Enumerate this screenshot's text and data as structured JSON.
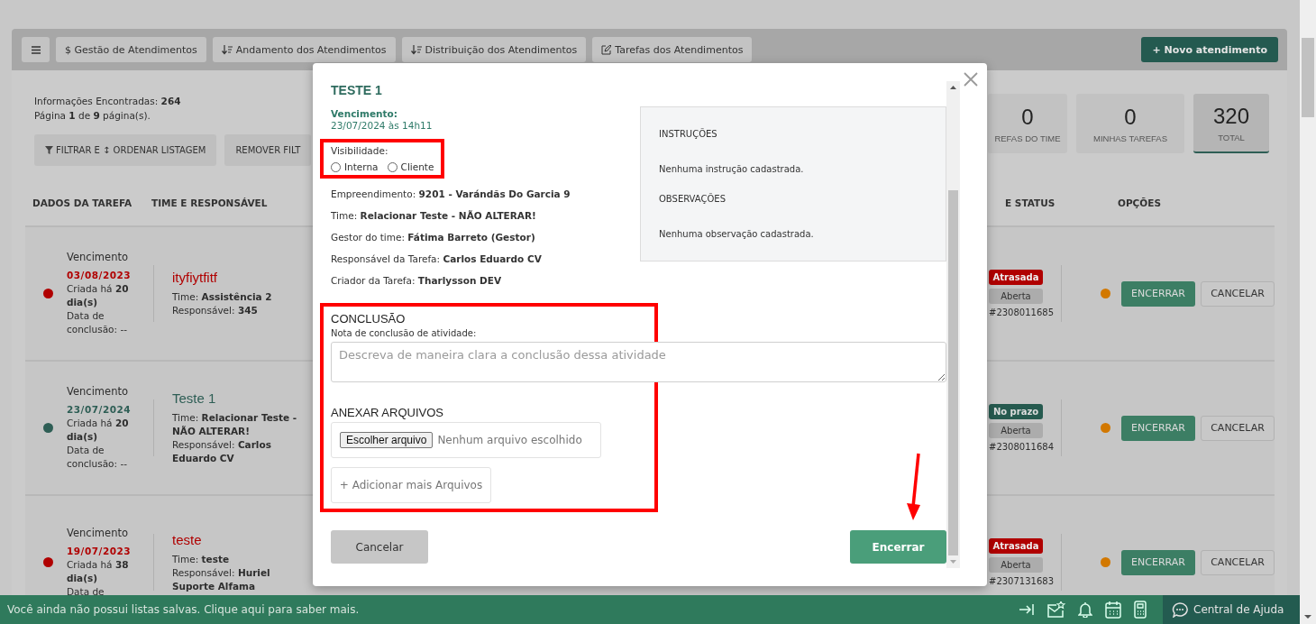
{
  "tabbar": {
    "tabs": [
      {
        "label": "$ Gestão de Atendimentos"
      },
      {
        "label": "Andamento dos Atendimentos"
      },
      {
        "label": "Distribuição dos Atendimentos"
      },
      {
        "label": "Tarefas dos Atendimentos"
      }
    ],
    "new_button": "+ Novo atendimento"
  },
  "summary": {
    "found": "Informações Encontradas: **264**",
    "page": "Página **1** de **9** página(s).",
    "filter_button": "FILTRAR E ↕ ORDENAR LISTAGEM",
    "remove_button": "REMOVER FILT"
  },
  "stats": [
    {
      "value": "0",
      "label": "REFAS DO TIME",
      "selected": false
    },
    {
      "value": "0",
      "label": "MINHAS TAREFAS",
      "selected": false
    },
    {
      "value": "320",
      "label": "TOTAL",
      "selected": true
    }
  ],
  "columns": [
    "DADOS DA TAREFA",
    "TIME E RESPONSÁVEL",
    "E STATUS",
    "OPÇÕES"
  ],
  "rows": [
    {
      "color": "#b00000",
      "due_label": "Vencimento",
      "due_date": "03/08/2023",
      "created": "Criada há **20 dia(s)**",
      "concluded": "Data de conclusão: --",
      "title": "ityfiytfitf",
      "team": "Time: **Assistência 2**",
      "responsible": "Responsável: **345**",
      "badges": [
        {
          "label": "Atrasada",
          "kind": "late"
        },
        {
          "label": "Aberta",
          "kind": "open"
        }
      ],
      "code": "#2308011685",
      "close_button": "ENCERRAR",
      "cancel_button": "CANCELAR"
    },
    {
      "color": "#2e5e55",
      "due_label": "Vencimento",
      "due_date": "23/07/2024",
      "created": "Criada há **20 dia(s)**",
      "concluded": "Data de conclusão: --",
      "title": "Teste 1",
      "team": "Time: **Relacionar Teste - NÃO ALTERAR!**",
      "responsible": "Responsável: **Carlos Eduardo CV**",
      "badges": [
        {
          "label": "No prazo",
          "kind": "on_time"
        },
        {
          "label": "Aberta",
          "kind": "open"
        }
      ],
      "code": "#2308011684",
      "close_button": "ENCERRAR",
      "cancel_button": "CANCELAR"
    },
    {
      "color": "#b00000",
      "due_label": "Vencimento",
      "due_date": "19/07/2023",
      "created": "Criada há **38 dia(s)**",
      "concluded": "Data de",
      "title": "teste",
      "team": "Time: **teste**",
      "responsible": "Responsável: **Huriel Suporte Alfama**",
      "badges": [
        {
          "label": "Atrasada",
          "kind": "late"
        },
        {
          "label": "Aberta",
          "kind": "open"
        }
      ],
      "code": "#2307131683",
      "close_button": "ENCERRAR",
      "cancel_button": "CANCELAR"
    }
  ],
  "modal": {
    "title": "TESTE 1",
    "due_label": "Vencimento:",
    "due_value": "23/07/2024 às 14h11",
    "visibility": {
      "highlighted": true,
      "label": "Visibilidade:",
      "options": [
        {
          "label": "Interna",
          "selected": false
        },
        {
          "label": "Cliente",
          "selected": false
        }
      ]
    },
    "fields": [
      "Empreendimento: **9201 - Varándãs Do Garcia 9**",
      "Time: **Relacionar Teste - NÃO ALTERAR!**",
      "Gestor do time: **Fátima Barreto (Gestor)**",
      "Responsável da Tarefa: **Carlos Eduardo CV**",
      "Criador da Tarefa: **Tharlysson DEV**"
    ],
    "info": [
      {
        "title": "INSTRUÇÕES",
        "text": "Nenhuma instrução cadastrada."
      },
      {
        "title": "OBSERVAÇÕES",
        "text": "Nenhuma observação cadastrada."
      }
    ],
    "conclusion": {
      "highlighted": true,
      "title": "CONCLUSÃO",
      "note_label": "Nota de conclusão de atividade:",
      "placeholder": "Descreva de maneira clara a conclusão dessa atividade",
      "attach_title": "ANEXAR ARQUIVOS",
      "choose_button": "Escolher arquivo",
      "file_status": "Nenhum arquivo escolhido",
      "add_button": "+ Adicionar mais Arquivos"
    },
    "cancel_button": "Cancelar",
    "submit_button": {
      "label": "Encerrar",
      "arrow": true
    }
  },
  "footer": {
    "message": "Você ainda não possui listas salvas. Clique aqui para saber mais.",
    "help": "Central de Ajuda"
  }
}
